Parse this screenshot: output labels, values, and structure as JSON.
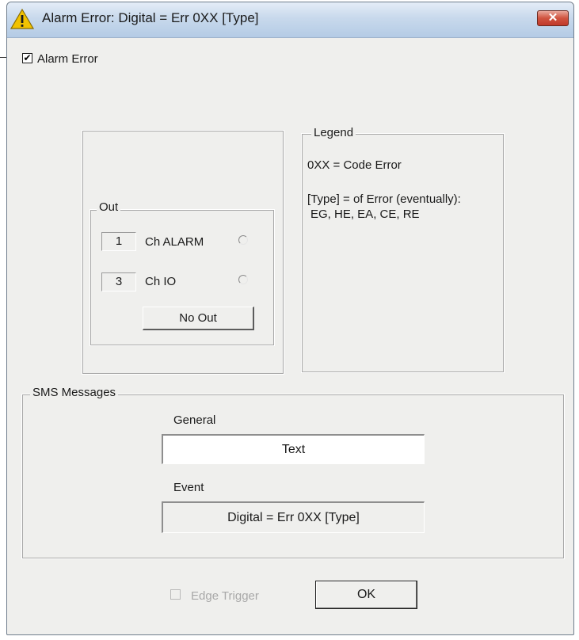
{
  "window": {
    "title": "Alarm Error: Digital = Err 0XX [Type]",
    "title_icon": "warning-icon",
    "close_glyph": "✕"
  },
  "alarm_error": {
    "label": "Alarm Error",
    "checked": true
  },
  "out_group": {
    "title": "Out",
    "rows": [
      {
        "number": "1",
        "label": "Ch ALARM",
        "selected": false
      },
      {
        "number": "3",
        "label": "Ch IO",
        "selected": false
      }
    ],
    "no_out_label": "No Out"
  },
  "legend": {
    "title": "Legend",
    "line1": "0XX = Code Error",
    "line2": "[Type] = of Error (eventually):",
    "line3": "EG, HE, EA, CE, RE"
  },
  "sms": {
    "title": "SMS Messages",
    "general_label": "General",
    "general_value": "Text",
    "event_label": "Event",
    "event_value": "Digital = Err 0XX [Type]"
  },
  "footer": {
    "edge_trigger_label": "Edge Trigger",
    "edge_trigger_enabled": false,
    "edge_trigger_checked": false,
    "ok_label": "OK"
  },
  "colors": {
    "dialog_bg": "#efefed",
    "titlebar": "#c8d9ec",
    "close_button": "#c0392b",
    "warning": "#f2c200"
  }
}
